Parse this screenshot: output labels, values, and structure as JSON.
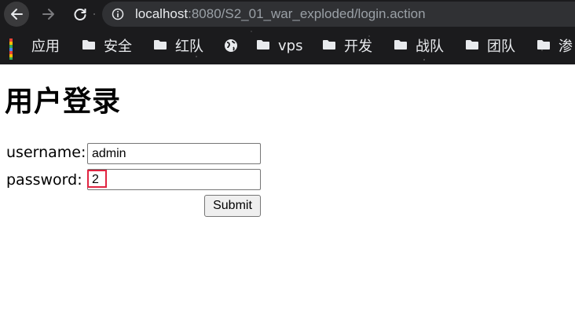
{
  "browser": {
    "url_host": "localhost",
    "url_rest": ":8080/S2_01_war_exploded/login.action",
    "bookmarks": [
      {
        "label": "应用",
        "icon": "apps-grid-icon"
      },
      {
        "label": "安全",
        "icon": "folder-icon"
      },
      {
        "label": "红队",
        "icon": "folder-icon"
      },
      {
        "label": "",
        "icon": "globe-icon"
      },
      {
        "label": "vps",
        "icon": "folder-icon"
      },
      {
        "label": "开发",
        "icon": "folder-icon"
      },
      {
        "label": "战队",
        "icon": "folder-icon"
      },
      {
        "label": "团队",
        "icon": "folder-icon"
      },
      {
        "label": "渗",
        "icon": "folder-icon"
      }
    ]
  },
  "page": {
    "title": "用户登录",
    "username_label": "username:",
    "username_value": "admin",
    "password_label": "password:",
    "password_value": "2",
    "submit_label": "Submit"
  },
  "colors": {
    "highlight_border": "#e02441",
    "chrome_bg": "#1b1b1d",
    "omnibox_bg": "#303134"
  }
}
